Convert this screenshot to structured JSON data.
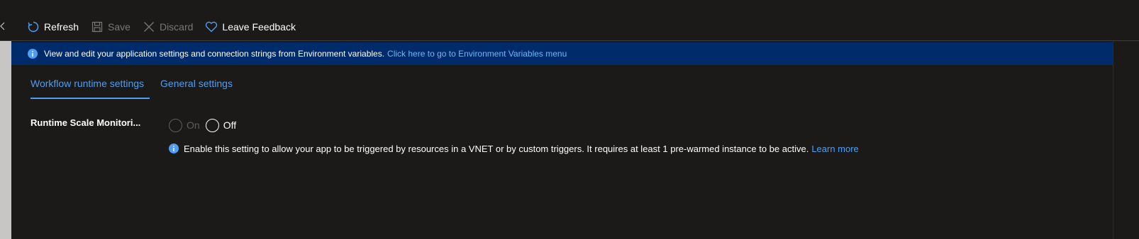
{
  "toolbar": {
    "refresh_label": "Refresh",
    "save_label": "Save",
    "discard_label": "Discard",
    "feedback_label": "Leave Feedback"
  },
  "banner": {
    "text": "View and edit your application settings and connection strings from Environment variables.",
    "link_text": "Click here to go to Environment Variables menu",
    "icon": "info-icon"
  },
  "tabs": [
    {
      "label": "Workflow runtime settings",
      "selected": true
    },
    {
      "label": "General settings",
      "selected": false
    }
  ],
  "setting": {
    "label": "Runtime Scale Monitori...",
    "options": [
      {
        "label": "On",
        "disabled": true
      },
      {
        "label": "Off",
        "disabled": false
      }
    ],
    "help_text": "Enable this setting to allow your app to be triggered by resources in a VNET or by custom triggers. It requires at least 1 pre-warmed instance to be active.",
    "help_link": "Learn more"
  },
  "colors": {
    "background": "#1b1a19",
    "banner": "#002b6a",
    "accent": "#4f9ef0"
  }
}
